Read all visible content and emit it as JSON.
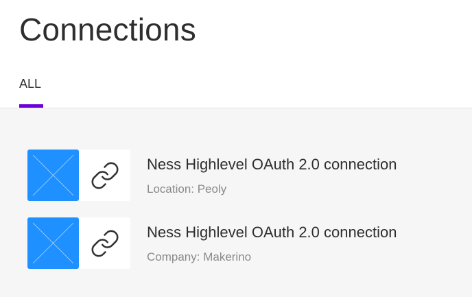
{
  "page": {
    "title": "Connections"
  },
  "tabs": [
    {
      "label": "ALL",
      "active": true
    }
  ],
  "colors": {
    "accent": "#6c00d6",
    "app_tile": "#1e90ff",
    "background": "#f6f6f6"
  },
  "connections": [
    {
      "name": "Ness Highlevel OAuth 2.0 connection",
      "detail": "Location: Peoly",
      "app_icon": "placeholder-x-icon",
      "link_icon": "link-icon"
    },
    {
      "name": "Ness Highlevel OAuth 2.0 connection",
      "detail": "Company: Makerino",
      "app_icon": "placeholder-x-icon",
      "link_icon": "link-icon"
    }
  ]
}
